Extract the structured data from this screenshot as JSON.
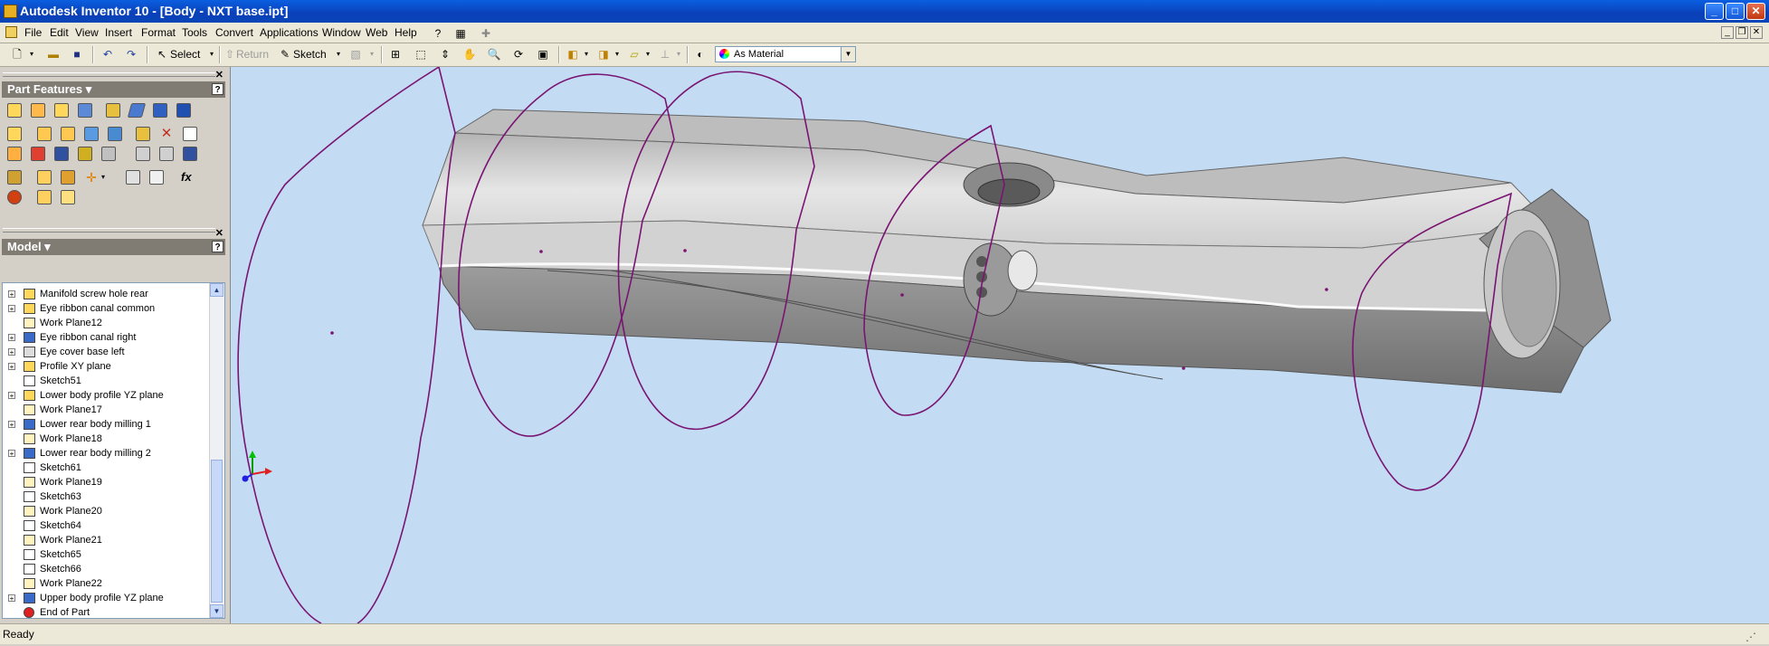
{
  "window": {
    "title": "Autodesk Inventor 10 - [Body - NXT base.ipt]",
    "controls": [
      "minimize",
      "maximize",
      "close"
    ]
  },
  "menu": {
    "items": [
      "File",
      "Edit",
      "View",
      "Insert",
      "Format",
      "Tools",
      "Convert",
      "Applications",
      "Window",
      "Web",
      "Help"
    ]
  },
  "toolbar": {
    "select_label": "Select",
    "return_label": "Return",
    "sketch_label": "Sketch",
    "appearance_value": "As Material"
  },
  "panels": {
    "features_title": "Part Features",
    "model_title": "Model",
    "help_glyph": "?"
  },
  "browser": {
    "items": [
      {
        "label": "Manifold screw hole rear",
        "icon": "hole-icon",
        "expandable": true
      },
      {
        "label": "Eye ribbon canal common",
        "icon": "extrude-icon",
        "expandable": true
      },
      {
        "label": "Work Plane12",
        "icon": "workplane-icon",
        "expandable": false
      },
      {
        "label": "Eye ribbon canal right",
        "icon": "sweep-icon",
        "expandable": true
      },
      {
        "label": "Eye cover base left",
        "icon": "mirror-icon",
        "expandable": true
      },
      {
        "label": "Profile XY plane",
        "icon": "extrude-icon",
        "expandable": true
      },
      {
        "label": "Sketch51",
        "icon": "sketch-icon",
        "expandable": false
      },
      {
        "label": "Lower body profile YZ plane",
        "icon": "extrude-icon",
        "expandable": true
      },
      {
        "label": "Work Plane17",
        "icon": "workplane-icon",
        "expandable": false
      },
      {
        "label": "Lower rear body milling 1",
        "icon": "sweep-icon",
        "expandable": true
      },
      {
        "label": "Work Plane18",
        "icon": "workplane-icon",
        "expandable": false
      },
      {
        "label": "Lower rear body milling 2",
        "icon": "sweep-icon",
        "expandable": true
      },
      {
        "label": "Sketch61",
        "icon": "sketch-icon",
        "expandable": false
      },
      {
        "label": "Work Plane19",
        "icon": "workplane-icon",
        "expandable": false
      },
      {
        "label": "Sketch63",
        "icon": "sketch-icon",
        "expandable": false
      },
      {
        "label": "Work Plane20",
        "icon": "workplane-icon",
        "expandable": false
      },
      {
        "label": "Sketch64",
        "icon": "sketch-icon",
        "expandable": false
      },
      {
        "label": "Work Plane21",
        "icon": "workplane-icon",
        "expandable": false
      },
      {
        "label": "Sketch65",
        "icon": "sketch-icon",
        "expandable": false
      },
      {
        "label": "Sketch66",
        "icon": "sketch-icon",
        "expandable": false
      },
      {
        "label": "Work Plane22",
        "icon": "workplane-icon",
        "expandable": false
      },
      {
        "label": "Upper body profile YZ plane",
        "icon": "sweep-icon",
        "expandable": true
      },
      {
        "label": "End of Part",
        "icon": "end-of-part-icon",
        "expandable": false
      }
    ]
  },
  "status": {
    "text": "Ready"
  },
  "colors": {
    "titlebar": "#0a3fb8",
    "viewport_bg": "#c3dcf4",
    "sketch_profile": "#7a1472",
    "end_of_part": "#e02020"
  }
}
